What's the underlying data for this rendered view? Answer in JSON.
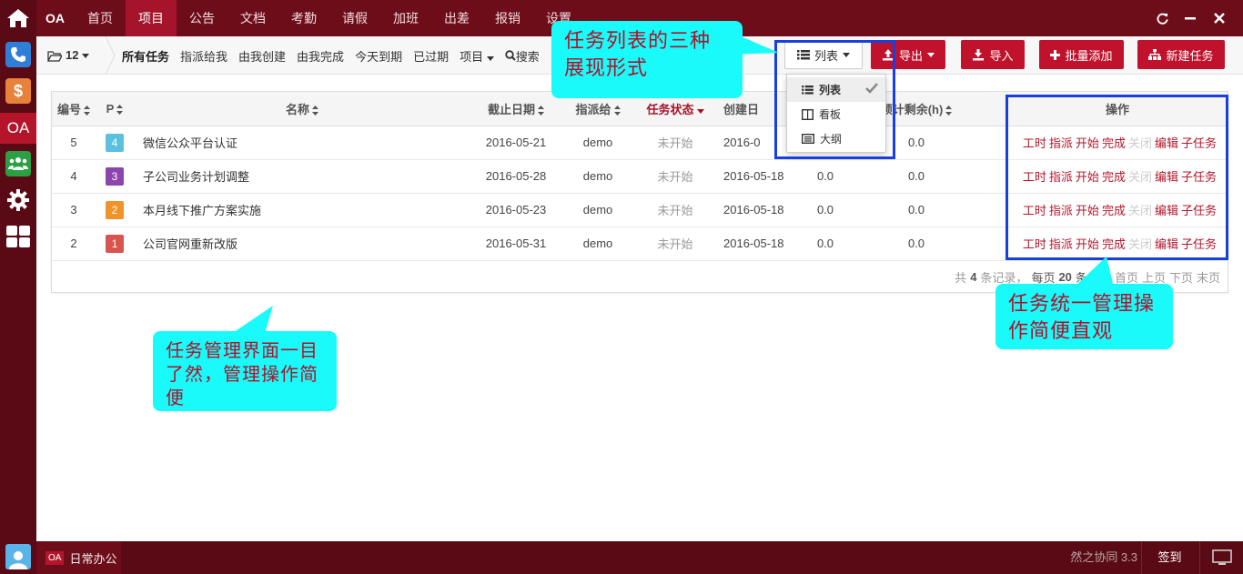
{
  "topbar": {
    "brand": "OA",
    "nav": [
      "首页",
      "项目",
      "公告",
      "文档",
      "考勤",
      "请假",
      "加班",
      "出差",
      "报销",
      "设置"
    ],
    "active_nav": "项目"
  },
  "subbar": {
    "folder_count": "12",
    "filters": [
      "所有任务",
      "指派给我",
      "由我创建",
      "由我完成",
      "今天到期",
      "已过期",
      "项目",
      "搜索"
    ],
    "view_button": "列表",
    "export_button": "导出",
    "import_button": "导入",
    "batch_add_button": "批量添加",
    "new_task_button": "新建任务"
  },
  "view_menu": {
    "items": [
      "列表",
      "看板",
      "大纲"
    ],
    "selected": "列表"
  },
  "table": {
    "columns": [
      "编号",
      "P",
      "名称",
      "截止日期",
      "指派给",
      "任务状态",
      "创建日",
      "预计剩余(h)",
      "操作"
    ],
    "rows": [
      {
        "id": "5",
        "priority": "4",
        "priority_color": "#5bc0de",
        "name": "微信公众平台认证",
        "due": "2016-05-21",
        "assignee": "demo",
        "status": "未开始",
        "created": "2016-0",
        "consumed": "",
        "left": "0.0"
      },
      {
        "id": "4",
        "priority": "3",
        "priority_color": "#8e44ad",
        "name": "子公司业务计划调整",
        "due": "2016-05-28",
        "assignee": "demo",
        "status": "未开始",
        "created": "2016-05-18",
        "consumed": "0.0",
        "left": "0.0"
      },
      {
        "id": "3",
        "priority": "2",
        "priority_color": "#f0932b",
        "name": "本月线下推广方案实施",
        "due": "2016-05-23",
        "assignee": "demo",
        "status": "未开始",
        "created": "2016-05-18",
        "consumed": "0.0",
        "left": "0.0"
      },
      {
        "id": "2",
        "priority": "1",
        "priority_color": "#d9534f",
        "name": "公司官网重新改版",
        "due": "2016-05-31",
        "assignee": "demo",
        "status": "未开始",
        "created": "2016-05-18",
        "consumed": "0.0",
        "left": "0.0"
      }
    ],
    "actions": [
      "工时",
      "指派",
      "开始",
      "完成",
      "关闭",
      "编辑",
      "子任务"
    ],
    "disabled_action": "关闭"
  },
  "pager": {
    "total_prefix": "共",
    "total": "4",
    "total_suffix": "条记录，",
    "per_page_prefix": "每页",
    "per_page": "20",
    "per_page_suffix": "条",
    "first": "首页",
    "prev": "上页",
    "next": "下页",
    "last": "末页"
  },
  "callouts": {
    "view_modes": "任务列表的三种展现形式",
    "unified_ops": "任务统一管理操作简便直观",
    "overview": "任务管理界面一目了然，管理操作简便"
  },
  "bottombar": {
    "task_badge": "OA",
    "task_label": "日常办公",
    "version": "然之协同 3.3",
    "checkin": "签到"
  },
  "colors": {
    "nav_bg": "#6e0d1a",
    "accent": "#c0122c",
    "callout_bg": "#19fbfb",
    "highlight": "#1a3fe0"
  }
}
